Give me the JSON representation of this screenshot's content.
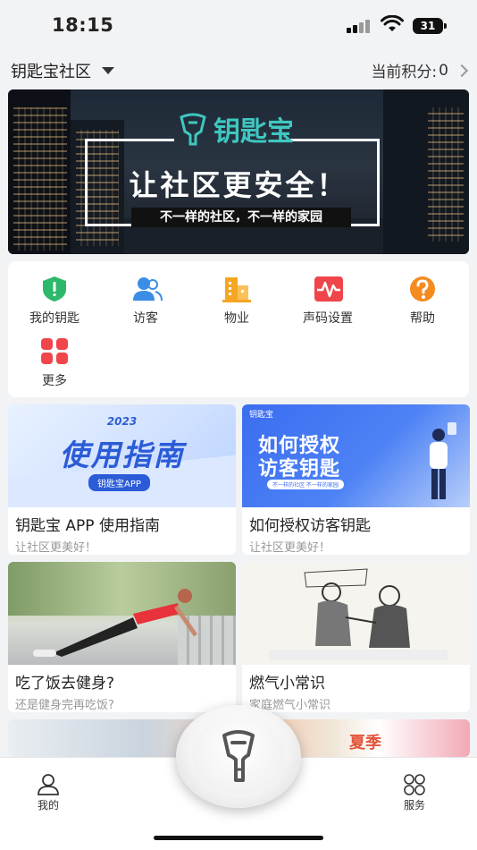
{
  "status": {
    "time": "18:15",
    "battery": "31"
  },
  "header": {
    "community": "钥匙宝社区",
    "points_label": "当前积分:",
    "points_value": "0"
  },
  "banner": {
    "brand": "钥匙宝",
    "slogan": "让社区更安全！",
    "subtitle": "不一样的社区，不一样的家园"
  },
  "menu": {
    "items": [
      {
        "label": "我的钥匙",
        "icon": "shield-icon",
        "color": "#2db86a"
      },
      {
        "label": "访客",
        "icon": "visitor-icon",
        "color": "#3a8ee6"
      },
      {
        "label": "物业",
        "icon": "building-icon",
        "color": "#f5a623"
      },
      {
        "label": "声码设置",
        "icon": "soundwave-icon",
        "color": "#f0454a"
      },
      {
        "label": "帮助",
        "icon": "help-icon",
        "color": "#f58a1f"
      },
      {
        "label": "更多",
        "icon": "grid-icon",
        "color": "#f0454a"
      }
    ]
  },
  "articles": [
    {
      "title": "钥匙宝 APP 使用指南",
      "subtitle": "让社区更美好！",
      "thumb_text": "使用指南",
      "thumb_year": "2023",
      "thumb_tag": "钥匙宝APP"
    },
    {
      "title": "如何授权访客钥匙",
      "subtitle": "让社区更美好！",
      "thumb_text_1": "如何授权",
      "thumb_text_2": "访客钥匙",
      "thumb_brand": "钥匙宝",
      "thumb_tag": "不一样的社区 不一样的家园"
    },
    {
      "title": "吃了饭去健身?",
      "subtitle": "还是健身完再吃饭?"
    },
    {
      "title": "燃气小常识",
      "subtitle": "家庭燃气小常识"
    }
  ],
  "partial_row": {
    "right_text": "夏季"
  },
  "tabbar": {
    "left_label": "我的",
    "right_label": "服务"
  }
}
